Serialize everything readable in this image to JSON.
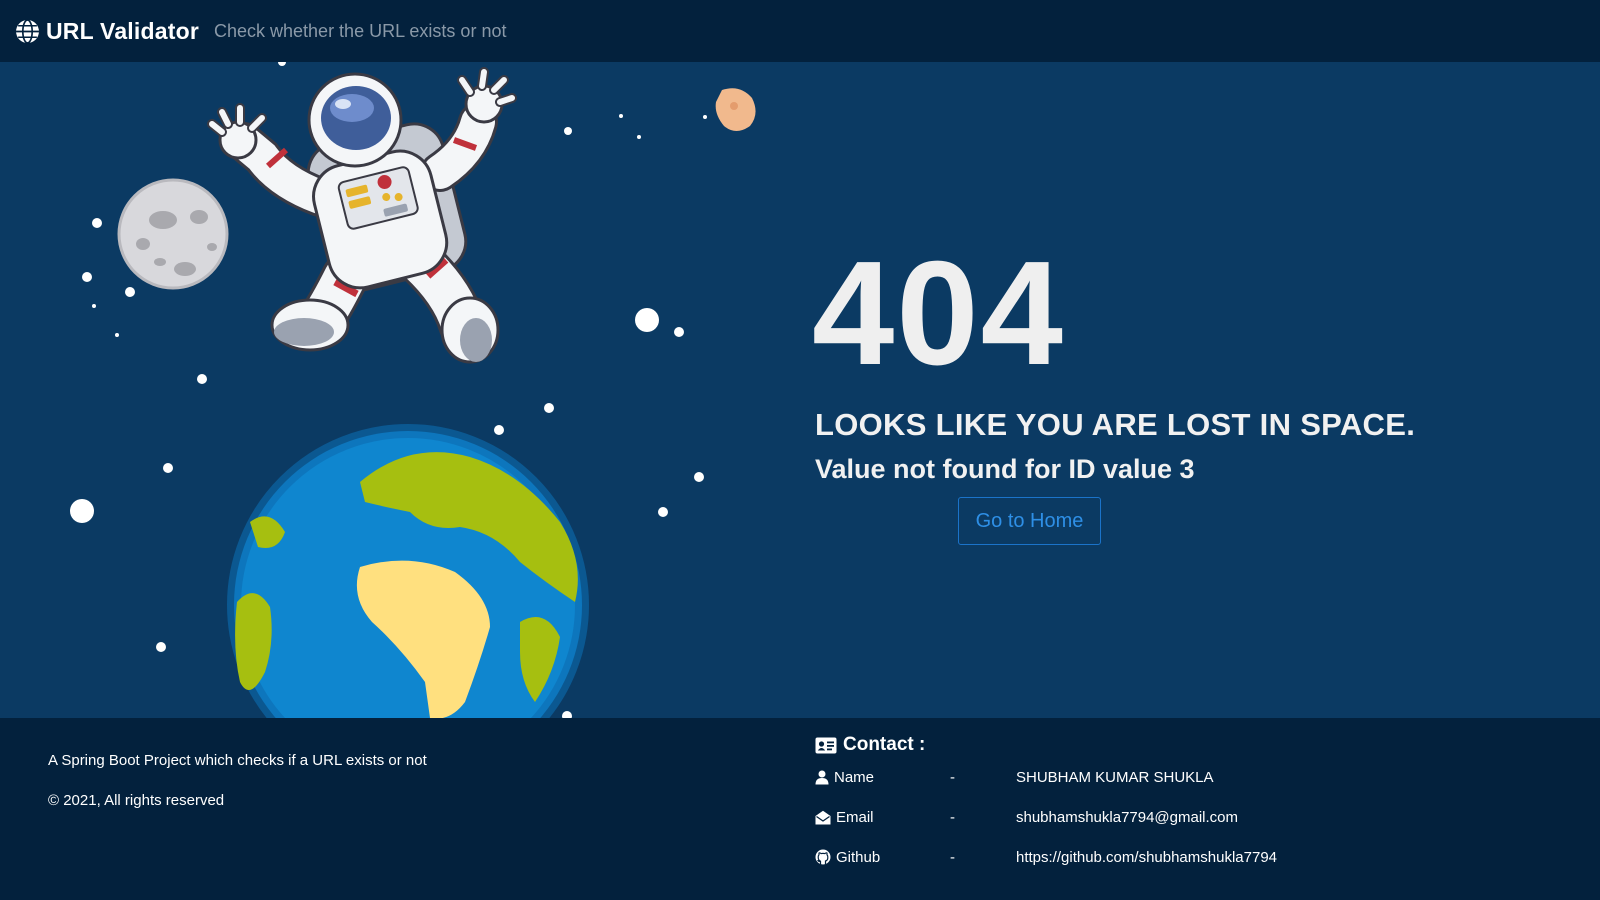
{
  "nav": {
    "brand": "URL Validator",
    "subtitle": "Check whether the URL exists or not",
    "brand_icon": "globe-icon"
  },
  "error": {
    "code": "404",
    "title": "LOOKS LIKE YOU ARE LOST IN SPACE.",
    "message": "Value not found for ID value 3",
    "button_label": "Go to Home"
  },
  "footer": {
    "description": "A Spring Boot Project which checks if a URL exists or not",
    "copyright": "© 2021, All rights reserved",
    "contact": {
      "title": "Contact :",
      "icon": "id-card-icon",
      "rows": [
        {
          "label": "Name",
          "dash": "-",
          "value": "SHUBHAM KUMAR SHUKLA",
          "icon": "user-icon"
        },
        {
          "label": "Email",
          "dash": "-",
          "value": "shubhamshukla7794@gmail.com",
          "icon": "envelope-icon"
        },
        {
          "label": "Github",
          "dash": "-",
          "value": "https://github.com/shubhamshukla7794",
          "icon": "github-icon"
        }
      ]
    }
  },
  "colors": {
    "navbar_bg": "#03213d",
    "main_bg": "#0b3a63",
    "button_accent": "#2e8fe6"
  }
}
